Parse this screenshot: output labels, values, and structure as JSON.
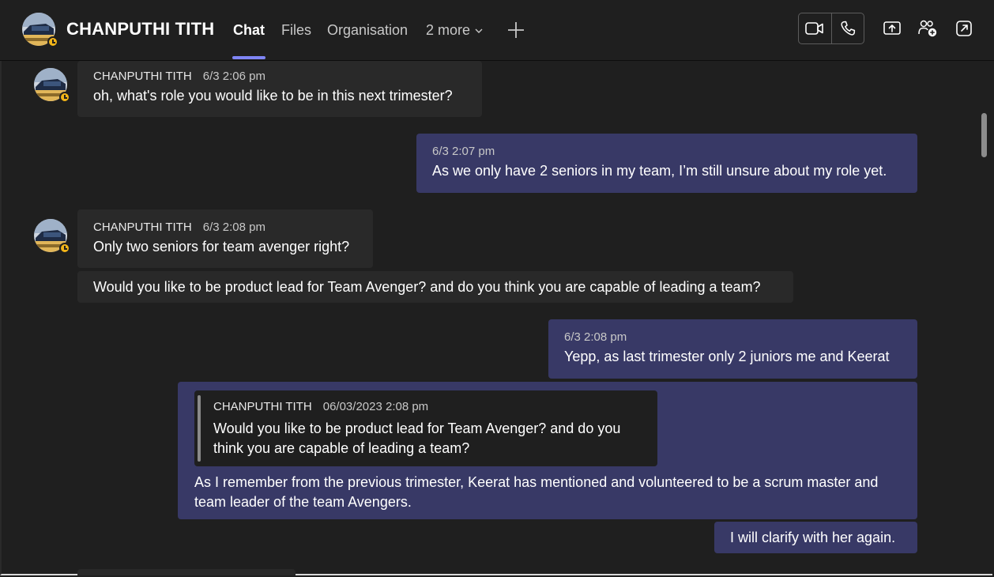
{
  "header": {
    "contact_name": "CHANPUTHI TITH",
    "tabs": [
      {
        "label": "Chat",
        "active": true
      },
      {
        "label": "Files",
        "active": false
      },
      {
        "label": "Organisation",
        "active": false
      },
      {
        "label": "2 more",
        "active": false
      }
    ],
    "icons": [
      "video-call-icon",
      "audio-call-icon",
      "share-screen-icon",
      "add-people-icon",
      "pop-out-icon"
    ]
  },
  "messages": [
    {
      "direction": "in",
      "author": "CHANPUTHI TITH",
      "time": "6/3 2:06 pm",
      "text": "oh, what's role you would like to be in this next trimester?"
    },
    {
      "direction": "out",
      "time": "6/3 2:07 pm",
      "text": "As we only have 2 seniors in my team,  I’m still unsure about my role yet."
    },
    {
      "direction": "in",
      "author": "CHANPUTHI TITH",
      "time": "6/3 2:08 pm",
      "text": "Only two seniors for team avenger right?"
    },
    {
      "direction": "in",
      "text": "Would you like to be product lead for Team Avenger? and do you think you are capable of leading a team?"
    },
    {
      "direction": "out",
      "time": "6/3 2:08 pm",
      "text": "Yepp, as last trimester only 2 juniors  me and Keerat"
    },
    {
      "direction": "out",
      "quote": {
        "author": "CHANPUTHI TITH",
        "time": "06/03/2023 2:08 pm",
        "line1": "Would you like to be product lead for Team Avenger? and do you",
        "line2": "think you are capable of leading a team?"
      },
      "line1": "As I remember from the previous trimester, Keerat has mentioned and volunteered to be a scrum master and",
      "line2": "team leader of the team Avengers."
    },
    {
      "direction": "out",
      "text": "I will clarify with her again."
    }
  ],
  "colors": {
    "background": "#1f1f1f",
    "incoming_bubble": "#292929",
    "outgoing_bubble": "#383966",
    "accent": "#7f85f5",
    "presence_away": "#f3b518"
  }
}
